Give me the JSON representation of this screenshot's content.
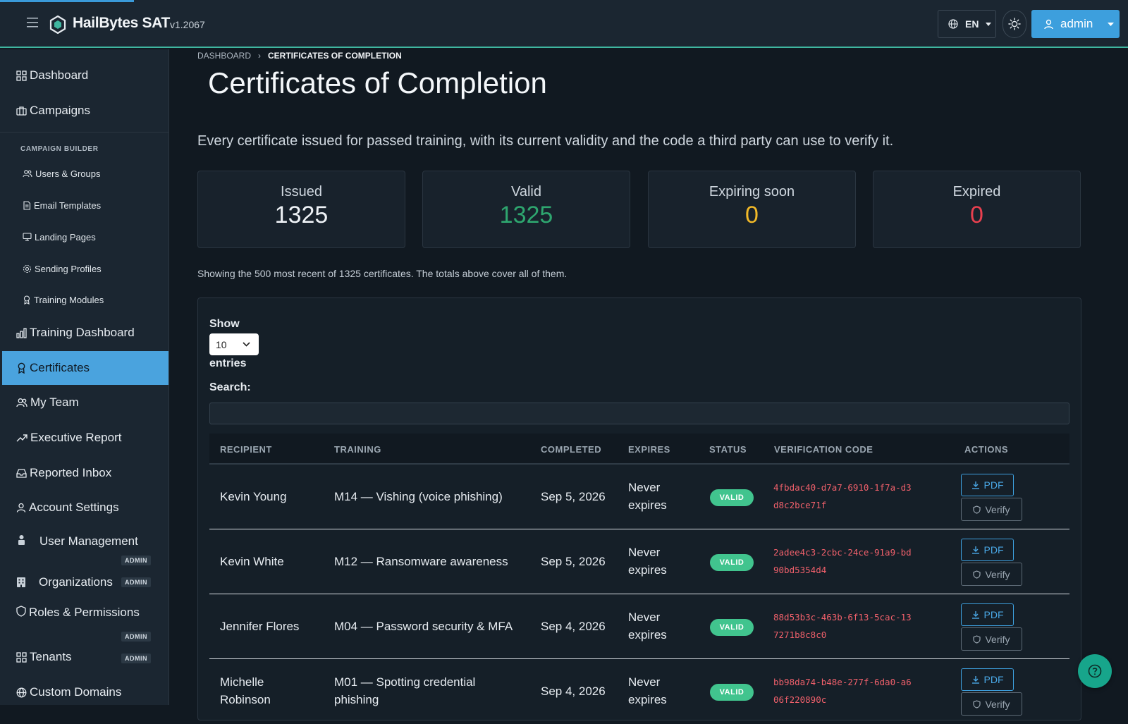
{
  "app": {
    "name": "HailBytes SAT",
    "version": "v1.2067"
  },
  "header": {
    "language": "EN",
    "user": "admin"
  },
  "sidebar": {
    "dashboard": "Dashboard",
    "campaigns": "Campaigns",
    "section_label": "CAMPAIGN BUILDER",
    "sub_items": [
      "Users & Groups",
      "Email Templates",
      "Landing Pages",
      "Sending Profiles",
      "Training Modules"
    ],
    "training_dashboard": "Training Dashboard",
    "certificates": "Certificates",
    "my_team": "My Team",
    "executive_report": "Executive Report",
    "reported_inbox": "Reported Inbox",
    "account_settings": "Account Settings",
    "user_management": "User Management",
    "organizations": "Organizations",
    "roles_permissions": "Roles & Permissions",
    "tenants": "Tenants",
    "custom_domains": "Custom Domains",
    "admin_badge": "ADMIN"
  },
  "breadcrumb": {
    "root": "DASHBOARD",
    "current": "CERTIFICATES OF COMPLETION"
  },
  "page": {
    "title": "Certificates of Completion",
    "subtitle": "Every certificate issued for passed training, with its current validity and the code a third party can use to verify it.",
    "note": "Showing the 500 most recent of 1325 certificates. The totals above cover all of them."
  },
  "stats": [
    {
      "label": "Issued",
      "value": "1325",
      "color": "#eef2f6"
    },
    {
      "label": "Valid",
      "value": "1325",
      "color": "#2ea66f"
    },
    {
      "label": "Expiring soon",
      "value": "0",
      "color": "#f1b928"
    },
    {
      "label": "Expired",
      "value": "0",
      "color": "#e8404f"
    }
  ],
  "table_controls": {
    "show_label": "Show",
    "page_size": "10",
    "entries_label": "entries",
    "search_label": "Search:",
    "search_value": ""
  },
  "table": {
    "headers": [
      "RECIPIENT",
      "TRAINING",
      "COMPLETED",
      "EXPIRES",
      "STATUS",
      "VERIFICATION CODE",
      "ACTIONS"
    ],
    "rows": [
      {
        "recipient": "Kevin Young",
        "training": "M14 — Vishing (voice phishing)",
        "completed": "Sep 5, 2026",
        "expires": "Never expires",
        "status": "VALID",
        "code": "4fbdac40-d7a7-6910-1f7a-d3d8c2bce71f"
      },
      {
        "recipient": "Kevin White",
        "training": "M12 — Ransomware awareness",
        "completed": "Sep 5, 2026",
        "expires": "Never expires",
        "status": "VALID",
        "code": "2adee4c3-2cbc-24ce-91a9-bd90bd5354d4"
      },
      {
        "recipient": "Jennifer Flores",
        "training": "M04 — Password security & MFA",
        "completed": "Sep 4, 2026",
        "expires": "Never expires",
        "status": "VALID",
        "code": "88d53b3c-463b-6f13-5cac-137271b8c8c0"
      },
      {
        "recipient": "Michelle Robinson",
        "training": "M01 — Spotting credential phishing",
        "completed": "Sep 4, 2026",
        "expires": "Never expires",
        "status": "VALID",
        "code": "bb98da74-b48e-277f-6da0-a606f220890c"
      }
    ],
    "pdf_label": "PDF",
    "verify_label": "Verify"
  }
}
